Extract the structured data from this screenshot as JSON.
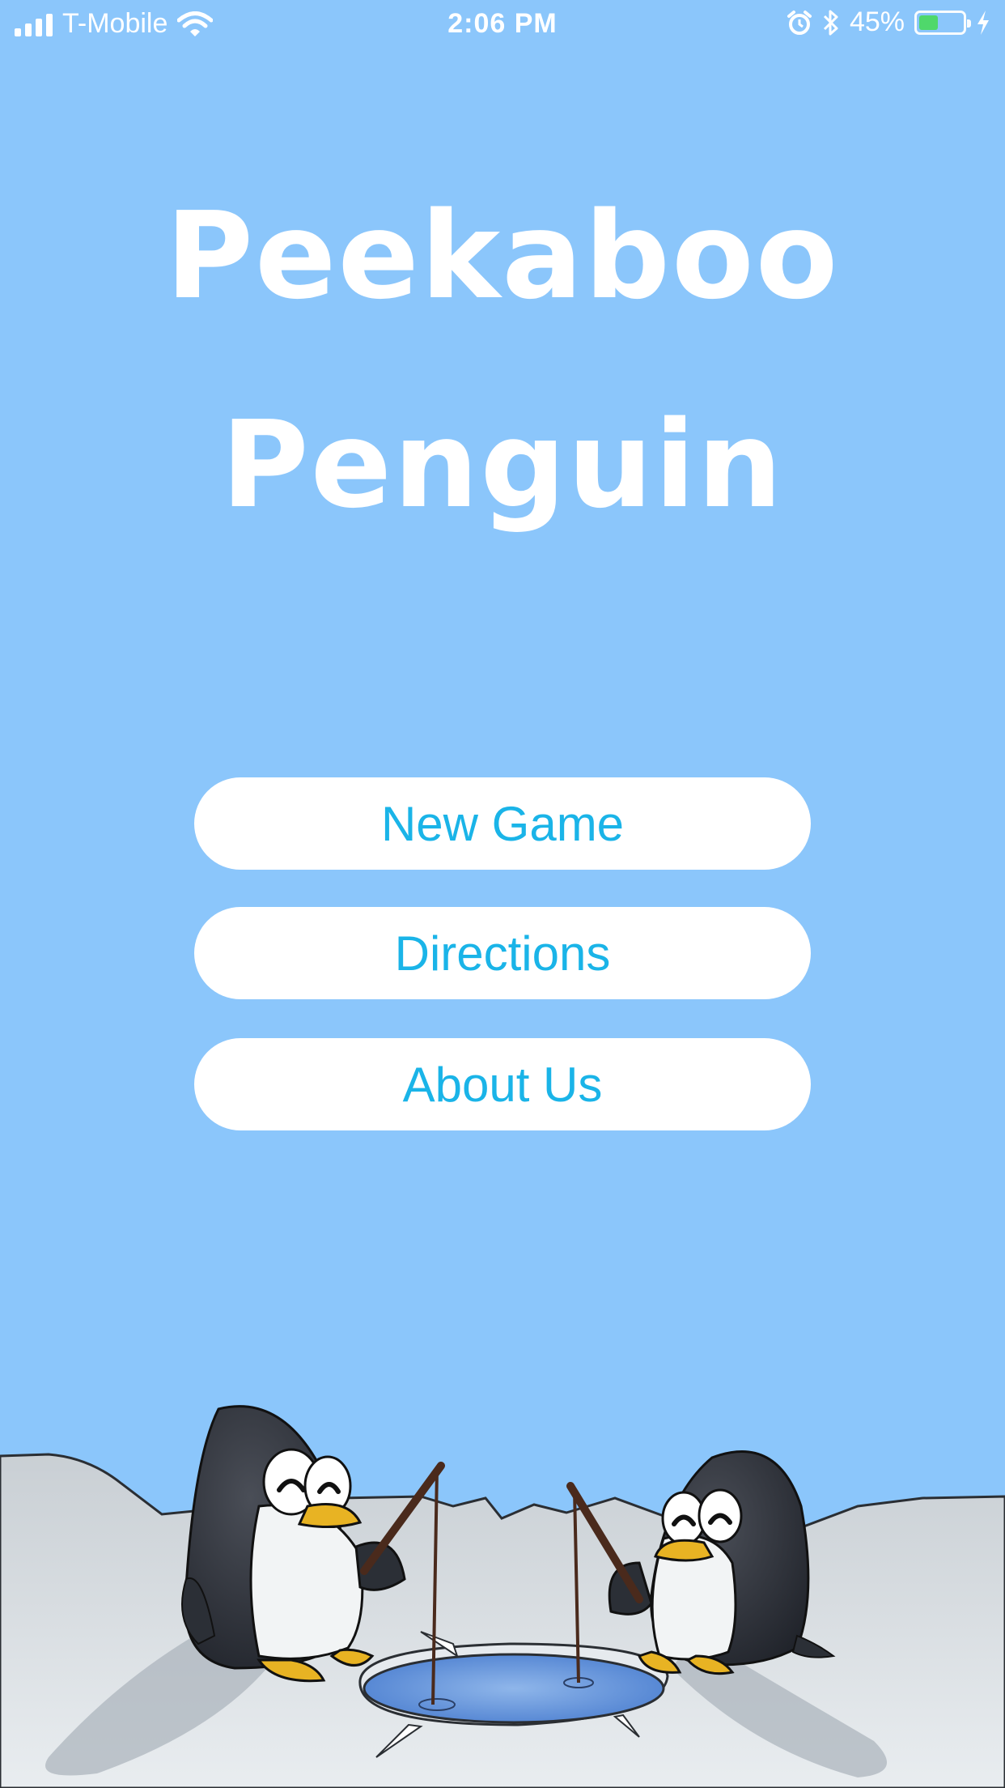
{
  "status_bar": {
    "carrier": "T-Mobile",
    "time": "2:06 PM",
    "battery_percent": "45%",
    "battery_level": 0.45,
    "icons": [
      "signal-icon",
      "wifi-icon",
      "alarm-icon",
      "bluetooth-icon",
      "battery-icon",
      "charging-icon"
    ]
  },
  "title": {
    "line1": "Peekaboo",
    "line2": "Penguin"
  },
  "menu": {
    "new_game": "New Game",
    "directions": "Directions",
    "about_us": "About Us"
  },
  "colors": {
    "background": "#8BC6FB",
    "button_bg": "#FFFFFF",
    "button_text": "#1AB4E8",
    "title_text": "#FFFFFF"
  }
}
